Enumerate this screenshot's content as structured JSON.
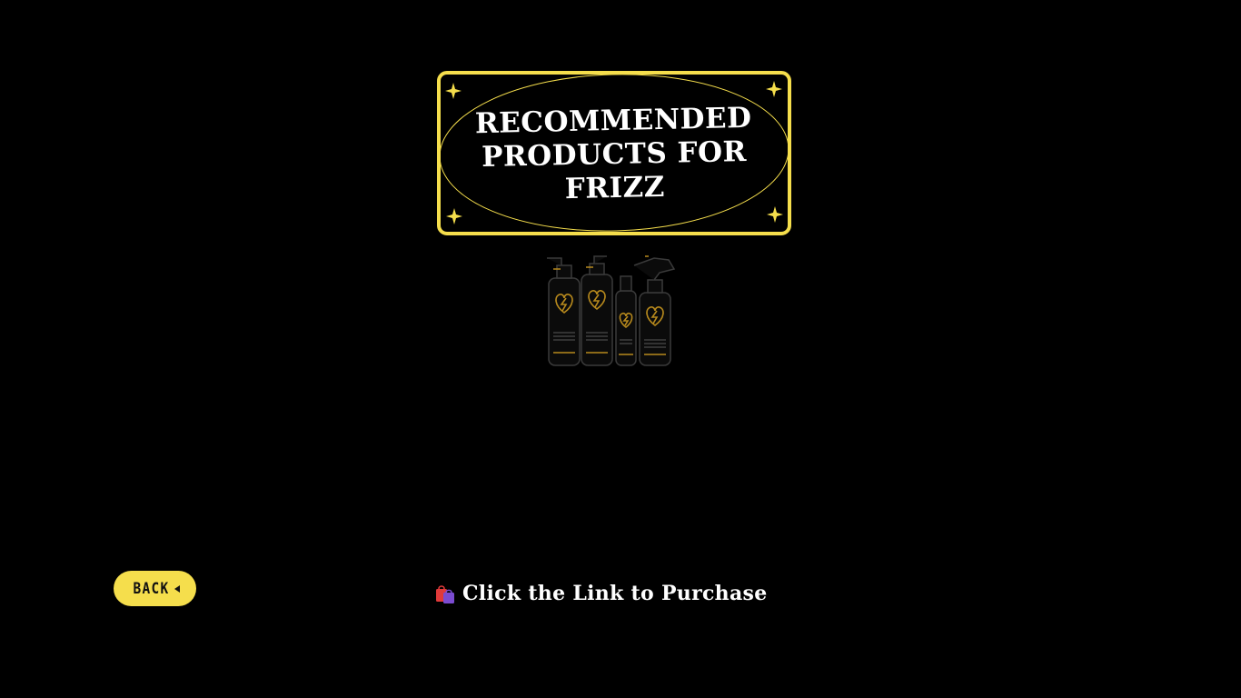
{
  "page": {
    "background_color": "#000000",
    "accent_color": "#f5de4c"
  },
  "title_badge": {
    "line1": "RECOMMENDED",
    "line2": "PRODUCTS FOR",
    "line3": "FRIZZ",
    "border_color": "#f5de4c"
  },
  "products_image": {
    "icon": "hair-product-bottles-icon"
  },
  "back_button": {
    "label": "BACK",
    "icon": "caret-left-icon"
  },
  "purchase": {
    "icon": "shopping-bags-icon",
    "text": "Click the Link to Purchase"
  }
}
